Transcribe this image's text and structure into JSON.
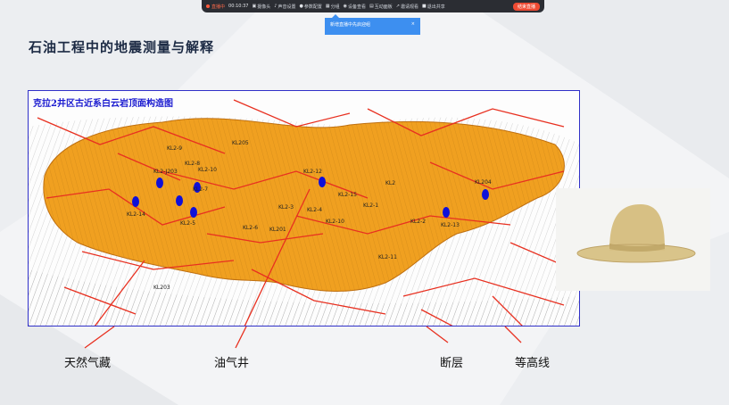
{
  "toolbar": {
    "live_label": "直播中",
    "time": "00:10:37",
    "items": [
      "摄像头",
      "声音设置",
      "参数配置",
      "分组",
      "设备查看",
      "互动面板",
      "邀请观看",
      "退出共享"
    ],
    "end_label": "结束直播"
  },
  "toast": {
    "text": "新增直播中先启迎组",
    "close": "×"
  },
  "slide": {
    "title": "石油工程中的地震测量与解释",
    "map_title": "克拉2井区古近系白云岩顶面构造图",
    "labels": {
      "gas": "天然气藏",
      "well": "油气井",
      "fault": "断层",
      "contour": "等高线"
    },
    "well_names": [
      "KL2-9",
      "KL2-8",
      "KL2-10",
      "KL2-7",
      "KL205",
      "KL2-12",
      "KL2-15",
      "KL2",
      "KL2-1",
      "KL2-14",
      "KL2-J203",
      "KL2-13",
      "KL2-6",
      "KL201",
      "KL2-3",
      "KL2-4",
      "KL2-5",
      "KL2-2",
      "KL2-11",
      "KL2-10",
      "KL204",
      "KL203"
    ]
  },
  "colors": {
    "accent": "#ef4b33",
    "map_fill": "#f0a020",
    "well": "#1010d8",
    "fault": "#e83020"
  }
}
